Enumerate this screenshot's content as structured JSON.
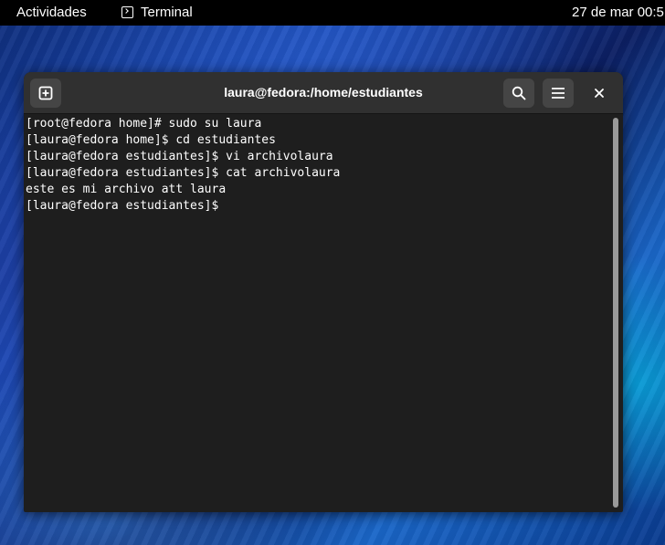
{
  "topbar": {
    "activities": "Actividades",
    "app_name": "Terminal",
    "app_icon": "terminal-icon",
    "clock": "27 de mar  00:5"
  },
  "window": {
    "title": "laura@fedora:/home/estudiantes",
    "buttons": {
      "new_tab_icon": "plus-square-icon",
      "search_icon": "search-icon",
      "menu_icon": "hamburger-menu-icon",
      "close_icon": "close-icon"
    }
  },
  "terminal": {
    "lines": [
      "[root@fedora home]# sudo su laura",
      "[laura@fedora home]$ cd estudiantes",
      "[laura@fedora estudiantes]$ vi archivolaura",
      "[laura@fedora estudiantes]$ cat archivolaura",
      "este es mi archivo att laura",
      "[laura@fedora estudiantes]$ "
    ]
  },
  "colors": {
    "topbar": "#000000",
    "headerbar": "#303030",
    "terminal_bg": "#1e1e1e",
    "terminal_fg": "#ffffff"
  }
}
